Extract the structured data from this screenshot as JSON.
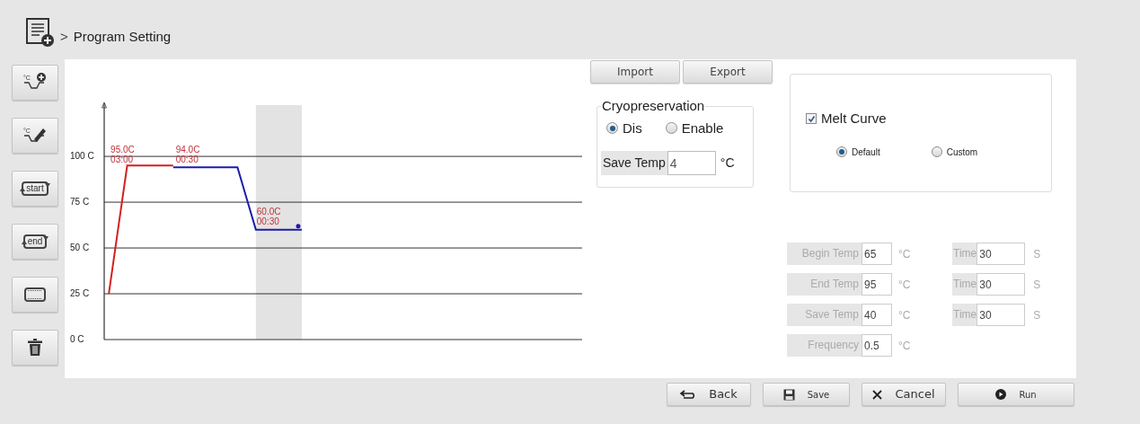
{
  "header": {
    "breadcrumb_separator": ">",
    "title": "Program Setting"
  },
  "toolbar": [
    {
      "kind": "add-step",
      "label": "°C"
    },
    {
      "kind": "edit-step",
      "label": "°C"
    },
    {
      "kind": "loop-start",
      "label": "start"
    },
    {
      "kind": "loop-end",
      "label": "end"
    },
    {
      "kind": "loop"
    },
    {
      "kind": "delete"
    }
  ],
  "chart_data": {
    "type": "line",
    "grid": true,
    "categories": [
      null,
      null,
      null,
      null,
      null,
      null,
      null,
      null,
      null,
      null,
      null,
      null,
      null,
      null,
      null,
      null,
      null,
      null,
      null,
      null,
      null,
      null,
      null,
      null,
      null,
      null,
      null,
      null,
      null,
      null,
      null,
      null,
      null,
      null,
      null,
      null,
      null,
      null,
      null,
      null,
      null,
      null,
      null,
      null,
      null,
      null,
      null,
      null,
      null,
      null,
      null,
      null
    ],
    "ylim": [
      0,
      128
    ],
    "yticks": [
      {
        "value": 0,
        "label": "0 C"
      },
      {
        "value": 25,
        "label": "25 C"
      },
      {
        "value": 50,
        "label": "50 C"
      },
      {
        "value": 75,
        "label": "75 C"
      },
      {
        "value": 100,
        "label": "100 C"
      }
    ],
    "series": [
      {
        "color": "#d42020",
        "values": [
          25,
          60,
          95,
          95,
          95,
          95,
          95,
          95,
          null,
          null,
          null,
          null,
          null,
          null,
          null,
          null,
          null,
          null,
          null,
          null,
          null,
          null,
          null,
          null,
          null,
          null,
          null,
          null,
          null,
          null,
          null,
          null,
          null,
          null,
          null,
          null,
          null,
          null,
          null,
          null,
          null,
          null,
          null,
          null,
          null,
          null,
          null,
          null,
          null,
          null,
          null,
          null
        ]
      },
      {
        "color": "#1c1ca8",
        "values": [
          null,
          null,
          null,
          null,
          null,
          null,
          null,
          94,
          94,
          94,
          94,
          94,
          94,
          94,
          94,
          77,
          60,
          60,
          60,
          60,
          60,
          60,
          null,
          null,
          null,
          null,
          null,
          null,
          null,
          null,
          null,
          null,
          null,
          null,
          null,
          null,
          null,
          null,
          null,
          null,
          null,
          null,
          null,
          null,
          null,
          null,
          null,
          null,
          null,
          null,
          null,
          null
        ]
      }
    ]
  },
  "steps": [
    {
      "temp": "95.0C",
      "time": "03:00",
      "selected": false
    },
    {
      "temp": "94.0C",
      "time": "00:30",
      "selected": false
    },
    {
      "temp": "60.0C",
      "time": "00:30",
      "selected": true
    }
  ],
  "file_buttons": [
    "Import",
    "Export"
  ],
  "cryopreservation": {
    "title": "Cryopreservation",
    "options": [
      {
        "label": "Dis",
        "selected": true
      },
      {
        "label": "Enable",
        "selected": false
      }
    ],
    "save_temp": {
      "label": "Save Temp",
      "value": "4",
      "unit": "°C"
    }
  },
  "melt_curve": {
    "label": "Melt Curve",
    "checked": true,
    "options": [
      {
        "label": "Default",
        "selected": true
      },
      {
        "label": "Custom",
        "selected": false
      }
    ]
  },
  "melt_fields": [
    {
      "label": "Begin Temp",
      "value": "65",
      "unit": "°C",
      "time_label": "Time",
      "time_value": "30",
      "time_unit": "S",
      "disabled": true
    },
    {
      "label": "End Temp",
      "value": "95",
      "unit": "°C",
      "time_label": "Time",
      "time_value": "30",
      "time_unit": "S",
      "disabled": true
    },
    {
      "label": "Save Temp",
      "value": "40",
      "unit": "°C",
      "time_label": "Time",
      "time_value": "30",
      "time_unit": "S",
      "disabled": true
    },
    {
      "label": "Frequency",
      "value": "0.5",
      "unit": "°C",
      "disabled": true
    }
  ],
  "actions": [
    {
      "kind": "back",
      "label": "Back"
    },
    {
      "kind": "save",
      "label": "Save"
    },
    {
      "kind": "cancel",
      "label": "Cancel"
    },
    {
      "kind": "run",
      "label": "Run"
    }
  ]
}
